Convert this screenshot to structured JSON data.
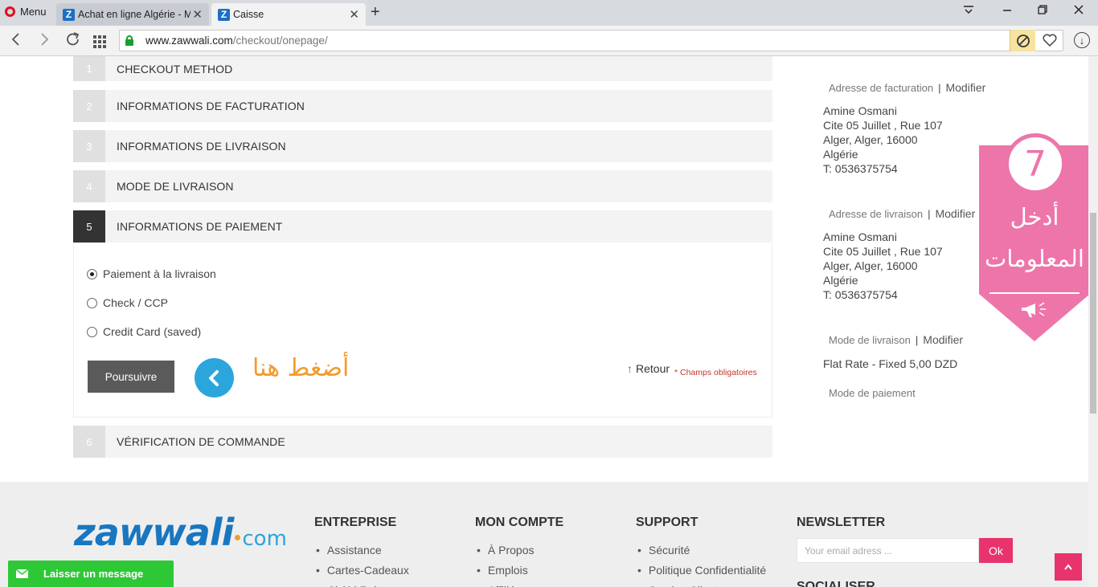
{
  "browser": {
    "menu_label": "Menu",
    "tabs": [
      {
        "title": "Achat en ligne Algérie - M"
      },
      {
        "title": "Caisse"
      }
    ],
    "url_host": "www.zawwali.com",
    "url_path": "/checkout/onepage/"
  },
  "checkout": {
    "steps": [
      {
        "num": "1",
        "label": "CHECKOUT METHOD"
      },
      {
        "num": "2",
        "label": "INFORMATIONS DE FACTURATION"
      },
      {
        "num": "3",
        "label": "INFORMATIONS DE LIVRAISON"
      },
      {
        "num": "4",
        "label": "MODE DE LIVRAISON"
      },
      {
        "num": "5",
        "label": "INFORMATIONS DE PAIEMENT"
      },
      {
        "num": "6",
        "label": "VÉRIFICATION DE COMMANDE"
      }
    ],
    "payment_options": [
      {
        "label": "Paiement à la livraison",
        "selected": true
      },
      {
        "label": "Check / CCP",
        "selected": false
      },
      {
        "label": "Credit Card (saved)",
        "selected": false
      }
    ],
    "continue_label": "Poursuivre",
    "press_here_ar": "أضغط هنا",
    "back_label": "Retour",
    "required_note": "* Champs obligatoires"
  },
  "progress": {
    "billing": {
      "title": "Adresse de facturation",
      "modify": "Modifier",
      "lines": [
        "Amine Osmani",
        "Cite 05 Juillet , Rue 107",
        "Alger, Alger, 16000",
        "Algérie",
        "T: 0536375754"
      ]
    },
    "shipping": {
      "title": "Adresse de livraison",
      "modify": "Modifier",
      "lines": [
        "Amine Osmani",
        "Cite 05 Juillet , Rue 107",
        "Alger, Alger, 16000",
        "Algérie",
        "T: 0536375754"
      ]
    },
    "shipping_method": {
      "title": "Mode de livraison",
      "modify": "Modifier",
      "value": "Flat Rate - Fixed 5,00 DZD"
    },
    "payment_method": {
      "title": "Mode de paiement"
    }
  },
  "ribbon": {
    "number": "7",
    "line1": "أدخل",
    "line2": "المعلومات"
  },
  "footer": {
    "logo_main": "zawwali",
    "logo_suffix": "com",
    "columns": [
      {
        "title": "ENTREPRISE",
        "items": [
          "Assistance",
          "Cartes-Cadeaux",
          "Chèbi Rebon"
        ]
      },
      {
        "title": "MON COMPTE",
        "items": [
          "À Propos",
          "Emplois",
          "Affiliés"
        ]
      },
      {
        "title": "SUPPORT",
        "items": [
          "Sécurité",
          "Politique Confidentialité",
          "Service Client"
        ]
      }
    ],
    "newsletter_title": "NEWSLETTER",
    "newsletter_placeholder": "Your email adress ...",
    "newsletter_ok": "Ok",
    "social_title": "SOCIALISER"
  },
  "livechat_label": "Laisser un message",
  "colors": {
    "accent_pink": "#e8336c",
    "ribbon_pink": "#ed75a9",
    "brand_blue": "#1976c0",
    "chat_green": "#2ec837",
    "arabic_orange": "#f39b2b"
  }
}
